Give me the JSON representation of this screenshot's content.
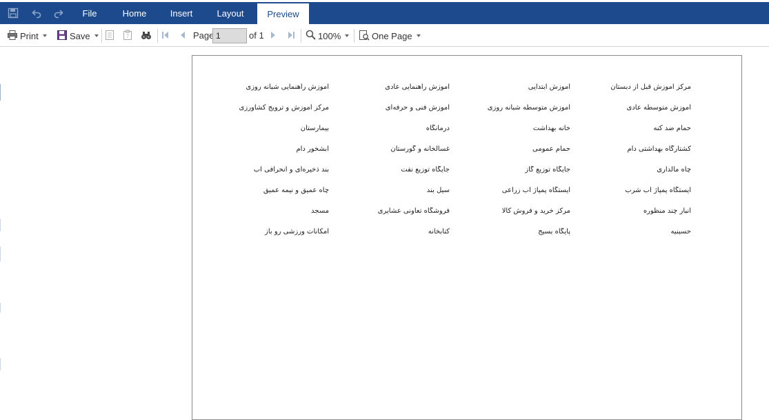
{
  "menubar": {
    "quick_access": [
      "save-icon",
      "undo-icon",
      "redo-icon"
    ],
    "tabs": [
      "File",
      "Home",
      "Insert",
      "Layout",
      "Preview"
    ],
    "active_tab": "Preview",
    "color": "#1c4a8c"
  },
  "toolbar": {
    "print_label": "Print",
    "save_label": "Save",
    "page_label": "Page",
    "page_value": "1",
    "of_label": "of 1",
    "zoom_label": "100%",
    "view_label": "One Page",
    "icons": [
      "printer-icon",
      "save-icon",
      "document-icon",
      "clipboard-icon",
      "binoculars-icon",
      "first-page-icon",
      "prev-page-icon",
      "next-page-icon",
      "last-page-icon",
      "zoom-icon",
      "page-view-icon"
    ]
  },
  "report": {
    "columns": 4,
    "items": [
      "مرکز آموزش قبل از دبستان",
      "آموزش ابتدایی",
      "آموزش راهنمایی عادی",
      "آموزش راهنمایی شبانه روزی",
      "آموزش متوسطه عادی",
      "آموزش متوسطه شبانه روزی",
      "آموزش فنی و حرفه‌ای",
      "مرکز آموزش و ترویج کشاورزی",
      "حمام ضد کنه",
      "خانه بهداشت",
      "درمانگاه",
      "بیمارستان",
      "کشتارگاه بهداشتی دام",
      "حمام عمومی",
      "غسالخانه و گورستان",
      "آبشخور دام",
      "چاه مالداری",
      "جایگاه توزیع گاز",
      "جایگاه توزیع نفت",
      "بند ذخیره‌ای و انحرافی آب",
      "ایستگاه پمپاژ آب شرب",
      "ایستگاه پمپاژ آب زراعی",
      "سیل بند",
      "چاه عمیق و نیمه عمیق",
      "انبار چند منظوره",
      "مرکز خرید و فروش کالا",
      "فروشگاه تعاونی عشایری",
      "مسجد",
      "حسینیه",
      "پایگاه بسیج",
      "کتابخانه",
      "امکانات ورزشی رو باز"
    ]
  }
}
